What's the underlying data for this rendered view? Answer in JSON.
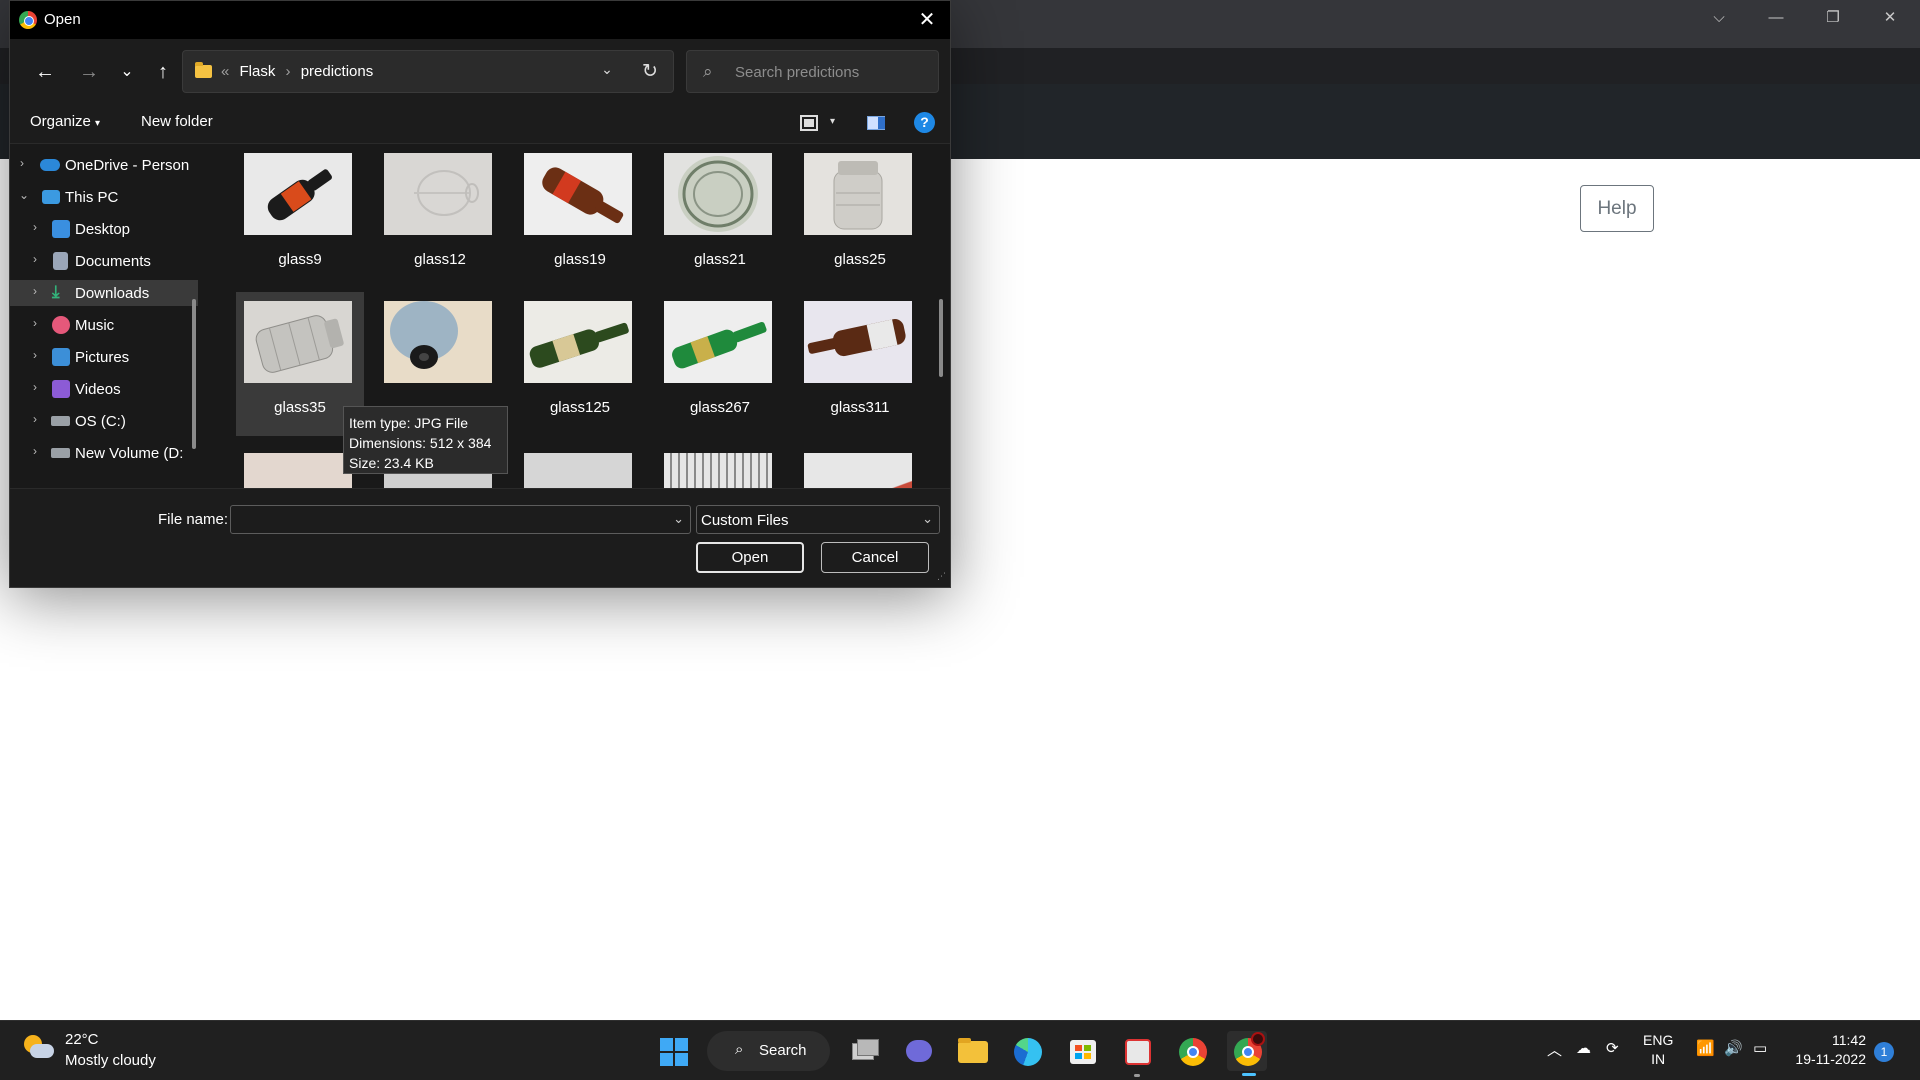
{
  "dialog": {
    "title": "Open",
    "close_glyph": "✕",
    "nav": {
      "back_glyph": "←",
      "forward_glyph": "→",
      "recent_glyph": "⌄",
      "up_glyph": "↑"
    },
    "breadcrumb": {
      "prefix": "«",
      "items": [
        "Flask",
        "predictions"
      ]
    },
    "search_placeholder": "Search predictions",
    "command_bar": {
      "organize": "Organize",
      "new_folder": "New folder"
    },
    "nav_pane": [
      {
        "label": "OneDrive - Person",
        "icon": "onedrive-icon",
        "color": "#2b88d8"
      },
      {
        "label": "This PC",
        "icon": "pc-icon",
        "color": "#3b9ae1"
      },
      {
        "label": "Desktop",
        "icon": "desktop-icon",
        "color": "#3a8fe0"
      },
      {
        "label": "Documents",
        "icon": "documents-icon",
        "color": "#9aa6b8"
      },
      {
        "label": "Downloads",
        "icon": "downloads-icon",
        "color": "#33b27a"
      },
      {
        "label": "Music",
        "icon": "music-icon",
        "color": "#e5587a"
      },
      {
        "label": "Pictures",
        "icon": "pictures-icon",
        "color": "#3c8fd8"
      },
      {
        "label": "Videos",
        "icon": "videos-icon",
        "color": "#8c5bd6"
      },
      {
        "label": "OS (C:)",
        "icon": "drive-icon",
        "color": "#9aa0a6"
      },
      {
        "label": "New Volume (D:",
        "icon": "drive-icon",
        "color": "#9aa0a6"
      }
    ],
    "files": [
      {
        "name": "glass9",
        "thumb": "dark-bottle"
      },
      {
        "name": "glass12",
        "thumb": "wine-glass"
      },
      {
        "name": "glass19",
        "thumb": "brown-bottle"
      },
      {
        "name": "glass21",
        "thumb": "jar-green"
      },
      {
        "name": "glass25",
        "thumb": "jar-clear"
      },
      {
        "name": "glass35",
        "thumb": "jar-clear"
      },
      {
        "name": "",
        "thumb": "bottle-top"
      },
      {
        "name": "glass125",
        "thumb": "green-bottle"
      },
      {
        "name": "glass267",
        "thumb": "green-bottle-2"
      },
      {
        "name": "glass311",
        "thumb": "brown-bottle-2"
      }
    ],
    "tooltip": [
      "Item type: JPG File",
      "Dimensions: 512 x 384",
      "Size: 23.4 KB"
    ],
    "file_name_label": "File name:",
    "file_name_value": "",
    "file_type": "Custom Files",
    "open_button": "Open",
    "cancel_button": "Cancel"
  },
  "browser": {
    "help_button": "Help"
  },
  "taskbar": {
    "weather_temp": "22°C",
    "weather_desc": "Mostly cloudy",
    "search_label": "Search",
    "lang_line1": "ENG",
    "lang_line2": "IN",
    "time": "11:42",
    "date": "19-11-2022",
    "notifications": "1"
  },
  "colors": {
    "accent": "#4cc2ff",
    "dialog_bg": "#1c1c1c",
    "page_header": "#212529"
  }
}
